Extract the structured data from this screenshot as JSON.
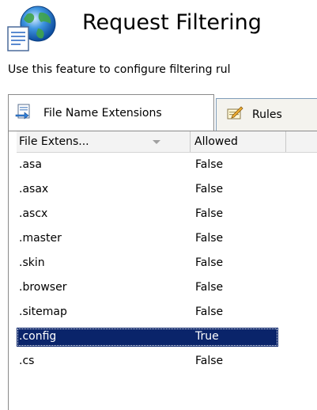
{
  "header": {
    "title": "Request Filtering",
    "icon": "request-filtering-globe-document-icon"
  },
  "description": "Use this feature to configure filtering rul",
  "tabs": [
    {
      "label": "File Name Extensions",
      "icon": "document-arrow-icon",
      "active": true
    },
    {
      "label": "Rules",
      "icon": "notepad-pencil-icon",
      "active": false
    }
  ],
  "grid": {
    "columns": {
      "name": "File Extens...",
      "allowed": "Allowed"
    },
    "rows": [
      {
        "extension": ".asa",
        "allowed": "False",
        "selected": false
      },
      {
        "extension": ".asax",
        "allowed": "False",
        "selected": false
      },
      {
        "extension": ".ascx",
        "allowed": "False",
        "selected": false
      },
      {
        "extension": ".master",
        "allowed": "False",
        "selected": false
      },
      {
        "extension": ".skin",
        "allowed": "False",
        "selected": false
      },
      {
        "extension": ".browser",
        "allowed": "False",
        "selected": false
      },
      {
        "extension": ".sitemap",
        "allowed": "False",
        "selected": false
      },
      {
        "extension": ".config",
        "allowed": "True",
        "selected": true
      },
      {
        "extension": ".cs",
        "allowed": "False",
        "selected": false
      }
    ]
  },
  "colors": {
    "selection": "#0a246a",
    "header_bg": "#f3f3f3",
    "tab_border": "#8a8a8a"
  }
}
